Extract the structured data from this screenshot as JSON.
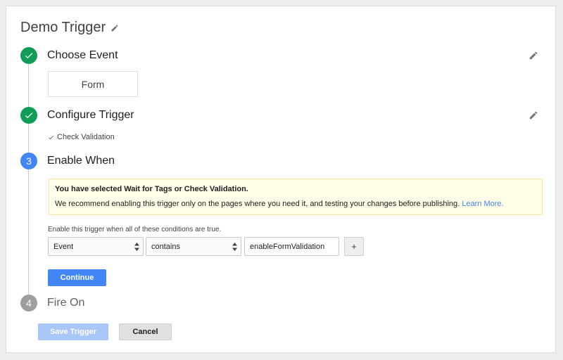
{
  "trigger": {
    "title": "Demo Trigger"
  },
  "steps": [
    {
      "number": "",
      "title": "Choose Event",
      "status": "done"
    },
    {
      "number": "",
      "title": "Configure Trigger",
      "status": "done"
    },
    {
      "number": "3",
      "title": "Enable When",
      "status": "active"
    },
    {
      "number": "4",
      "title": "Fire On",
      "status": "pending"
    }
  ],
  "choose_event": {
    "value": "Form"
  },
  "configure_trigger": {
    "summary": "Check Validation"
  },
  "enable_when": {
    "warning_title": "You have selected Wait for Tags or Check Validation.",
    "warning_body": "We recommend enabling this trigger only on the pages where you need it, and testing your changes before publishing.",
    "warning_link": "Learn More.",
    "conditions_label": "Enable this trigger when all of these conditions are true.",
    "condition": {
      "variable": "Event",
      "operator": "contains",
      "value": "enableFormValidation"
    },
    "add_label": "+",
    "continue_label": "Continue"
  },
  "footer": {
    "save_label": "Save Trigger",
    "cancel_label": "Cancel"
  },
  "colors": {
    "done": "#0f9d58",
    "active": "#4285f4",
    "pending": "#9e9e9e"
  },
  "icons": {
    "edit": "pencil-icon",
    "done": "checkmark-icon",
    "select": "select-arrows-icon"
  }
}
